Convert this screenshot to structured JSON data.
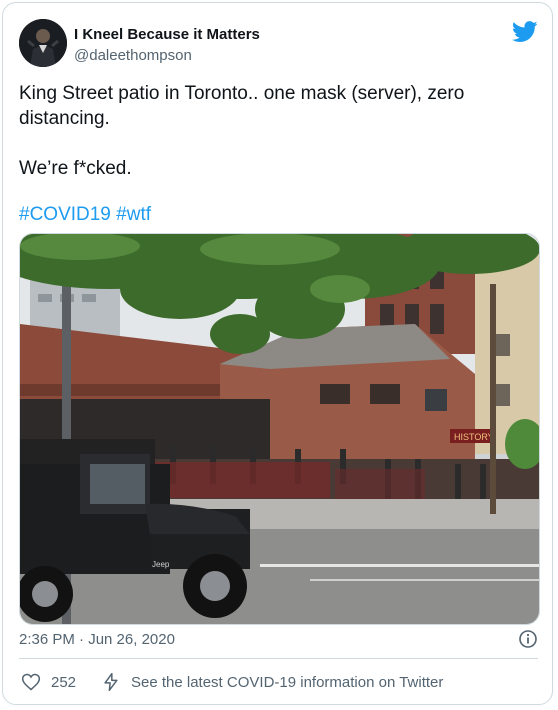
{
  "author": {
    "name": "I Kneel Because it Matters",
    "handle": "@daleethompson",
    "avatar_icon": "avatar"
  },
  "tweet": {
    "line1": "King Street patio in Toronto.. one mask (server), zero distancing.",
    "line2": "We’re f*cked.",
    "hashtags": [
      "#COVID19",
      "#wtf"
    ],
    "photo_jeep_badge": "Jeep"
  },
  "meta": {
    "timestamp": "2:36 PM · Jun 26, 2020"
  },
  "actions": {
    "like_count": "252",
    "covid_info": "See the latest COVID-19 information on Twitter"
  },
  "colors": {
    "accent": "#1d9bf0",
    "text": "#0f1419",
    "muted": "#536471",
    "border": "#cfd9de"
  }
}
